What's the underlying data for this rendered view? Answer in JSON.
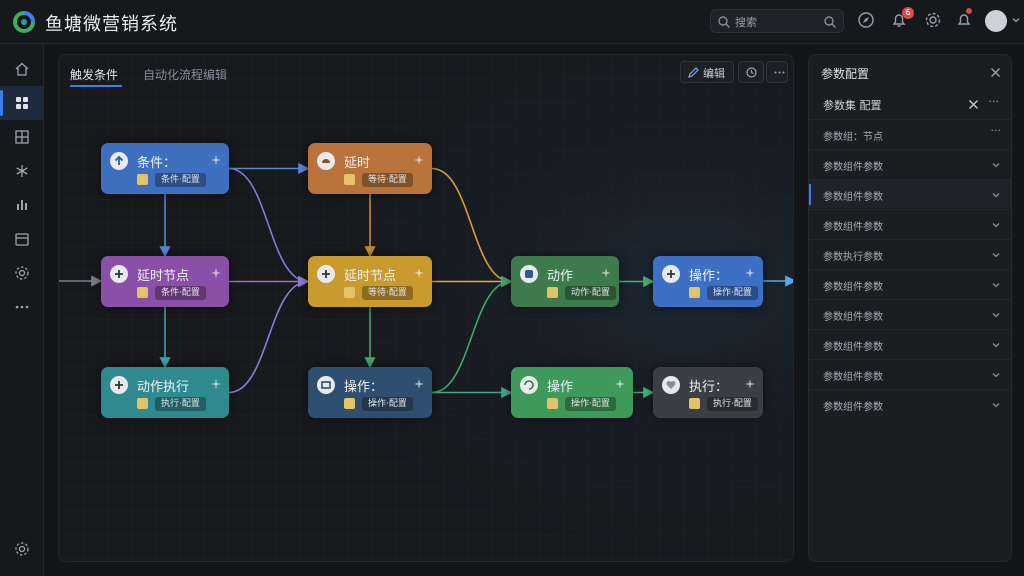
{
  "app": {
    "title": "鱼塘微营销系统",
    "search_placeholder": "搜索",
    "notification_count": "6",
    "brand_color": "#3d7df2"
  },
  "rail": {
    "icons": [
      "home-icon",
      "dashboard-icon",
      "grid-icon",
      "snowflake-icon",
      "chart-icon",
      "calendar-icon",
      "settings-icon",
      "more-icon",
      "gear-icon"
    ],
    "active_index": 1
  },
  "canvas": {
    "tabs": [
      {
        "label": "触发条件"
      },
      {
        "label": "自动化流程编辑"
      }
    ],
    "tool_button_label": "编辑",
    "nodes": [
      {
        "id": "n1",
        "title": "条件：",
        "chip": "条件·配置",
        "color": "#3f6fbf",
        "icon": "arrow-up-icon"
      },
      {
        "id": "n2",
        "title": "延时",
        "chip": "等待·配置",
        "color": "#b8733a",
        "icon": "clock-icon"
      },
      {
        "id": "n3",
        "title": "延时节点",
        "chip": "条件·配置",
        "color": "#8a4fa6",
        "icon": "plus-icon"
      },
      {
        "id": "n4",
        "title": "延时节点",
        "chip": "等待·配置",
        "color": "#c99a2e",
        "icon": "plus-icon"
      },
      {
        "id": "n5",
        "title": "动作",
        "chip": "动作·配置",
        "color": "#3d7a4c",
        "icon": "action-icon"
      },
      {
        "id": "n6",
        "title": "操作：",
        "chip": "操作·配置",
        "color": "#3d6fc2",
        "icon": "plus-icon"
      },
      {
        "id": "n7",
        "title": "动作执行",
        "chip": "执行·配置",
        "color": "#2e8a8e",
        "icon": "plus-icon"
      },
      {
        "id": "n8",
        "title": "操作：",
        "chip": "操作·配置",
        "color": "#2f4f70",
        "icon": "box-icon"
      },
      {
        "id": "n9",
        "title": "操作",
        "chip": "操作·配置",
        "color": "#3d9a5a",
        "icon": "cycle-icon"
      },
      {
        "id": "n10",
        "title": "执行：",
        "chip": "执行·配置",
        "color": "#3c3e44",
        "icon": "heart-icon"
      }
    ]
  },
  "params": {
    "title": "参数配置",
    "subtitle": "参数集 配置",
    "rows": [
      {
        "label": "参数组：节点"
      },
      {
        "label": "参数组件参数"
      },
      {
        "label": "参数组件参数"
      },
      {
        "label": "参数组件参数"
      },
      {
        "label": "参数执行参数"
      },
      {
        "label": "参数组件参数"
      },
      {
        "label": "参数组件参数"
      },
      {
        "label": "参数组件参数"
      },
      {
        "label": "参数组件参数"
      },
      {
        "label": "参数组件参数"
      }
    ]
  }
}
